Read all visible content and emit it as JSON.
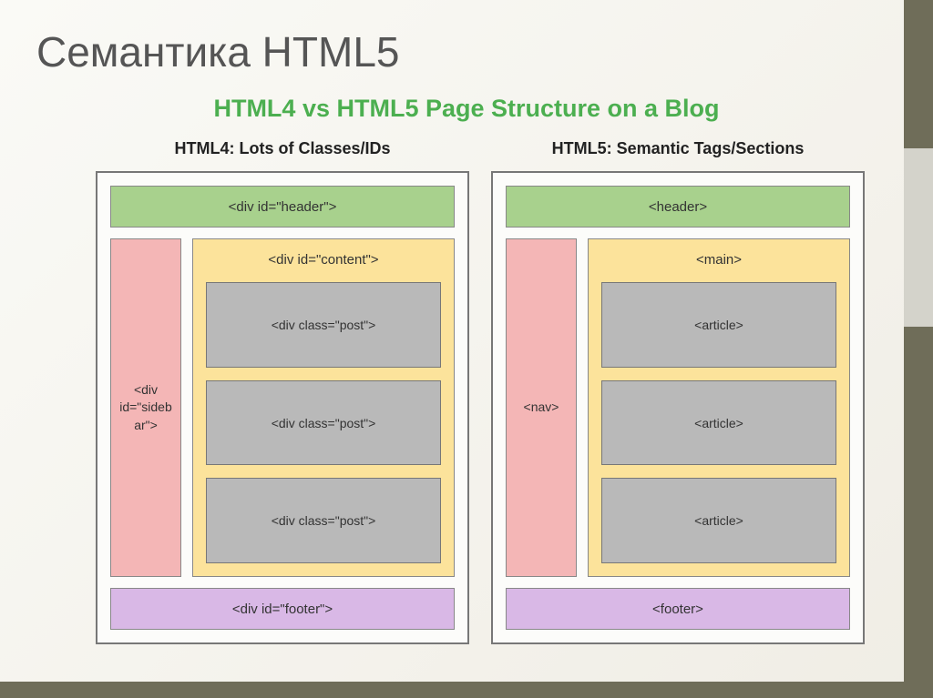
{
  "page_title": "Семантика HTML5",
  "diagram_title": "HTML4 vs HTML5 Page Structure on a Blog",
  "html4": {
    "col_title": "HTML4: Lots of Classes/IDs",
    "header": "<div id=\"header\">",
    "sidebar": "<div id=\"sideb ar\">",
    "content": "<div id=\"content\">",
    "posts": [
      "<div class=\"post\">",
      "<div class=\"post\">",
      "<div class=\"post\">"
    ],
    "footer": "<div id=\"footer\">"
  },
  "html5": {
    "col_title": "HTML5: Semantic Tags/Sections",
    "header": "<header>",
    "sidebar": "<nav>",
    "content": "<main>",
    "posts": [
      "<article>",
      "<article>",
      "<article>"
    ],
    "footer": "<footer>"
  }
}
